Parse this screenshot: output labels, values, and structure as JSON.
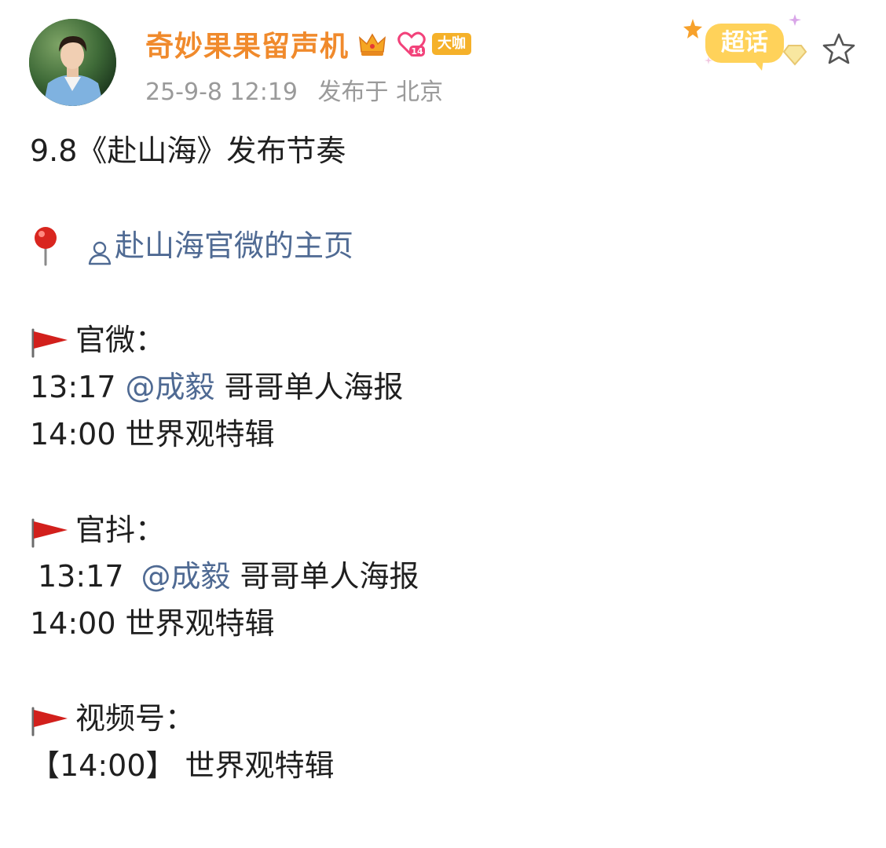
{
  "header": {
    "username": "奇妙果果留声机",
    "badge_label": "大咖",
    "level_badge": "14",
    "timestamp": "25-9-8 12:19",
    "location": "发布于 北京",
    "supertopic_label": "超话"
  },
  "post": {
    "title": "9.8《赴山海》发布节奏",
    "homepage_link": "赴山海官微的主页",
    "sections": [
      {
        "heading": "官微：",
        "items": [
          {
            "time": "13:17",
            "mention": "@成毅",
            "text": "哥哥单人海报"
          },
          {
            "time": "14:00",
            "text": "世界观特辑"
          }
        ]
      },
      {
        "heading": "官抖：",
        "items": [
          {
            "time": " 13:17",
            "mention": "@成毅",
            "text": "哥哥单人海报"
          },
          {
            "time": "14:00",
            "text": "世界观特辑"
          }
        ]
      },
      {
        "heading": "视频号：",
        "items": [
          {
            "time": "【14:00】",
            "text": "世界观特辑"
          }
        ]
      }
    ]
  },
  "icons": {
    "pin": "pushpin-icon",
    "flag": "triangular-flag-icon",
    "user": "user-outline-icon",
    "star": "star-outline-icon",
    "crown": "crown-icon",
    "heart_level": "heart-level-icon"
  },
  "colors": {
    "username": "#f08a2c",
    "link": "#4f6a93",
    "meta": "#9a9a9a",
    "badge": "#f5b12a",
    "flag": "#d2201c"
  }
}
